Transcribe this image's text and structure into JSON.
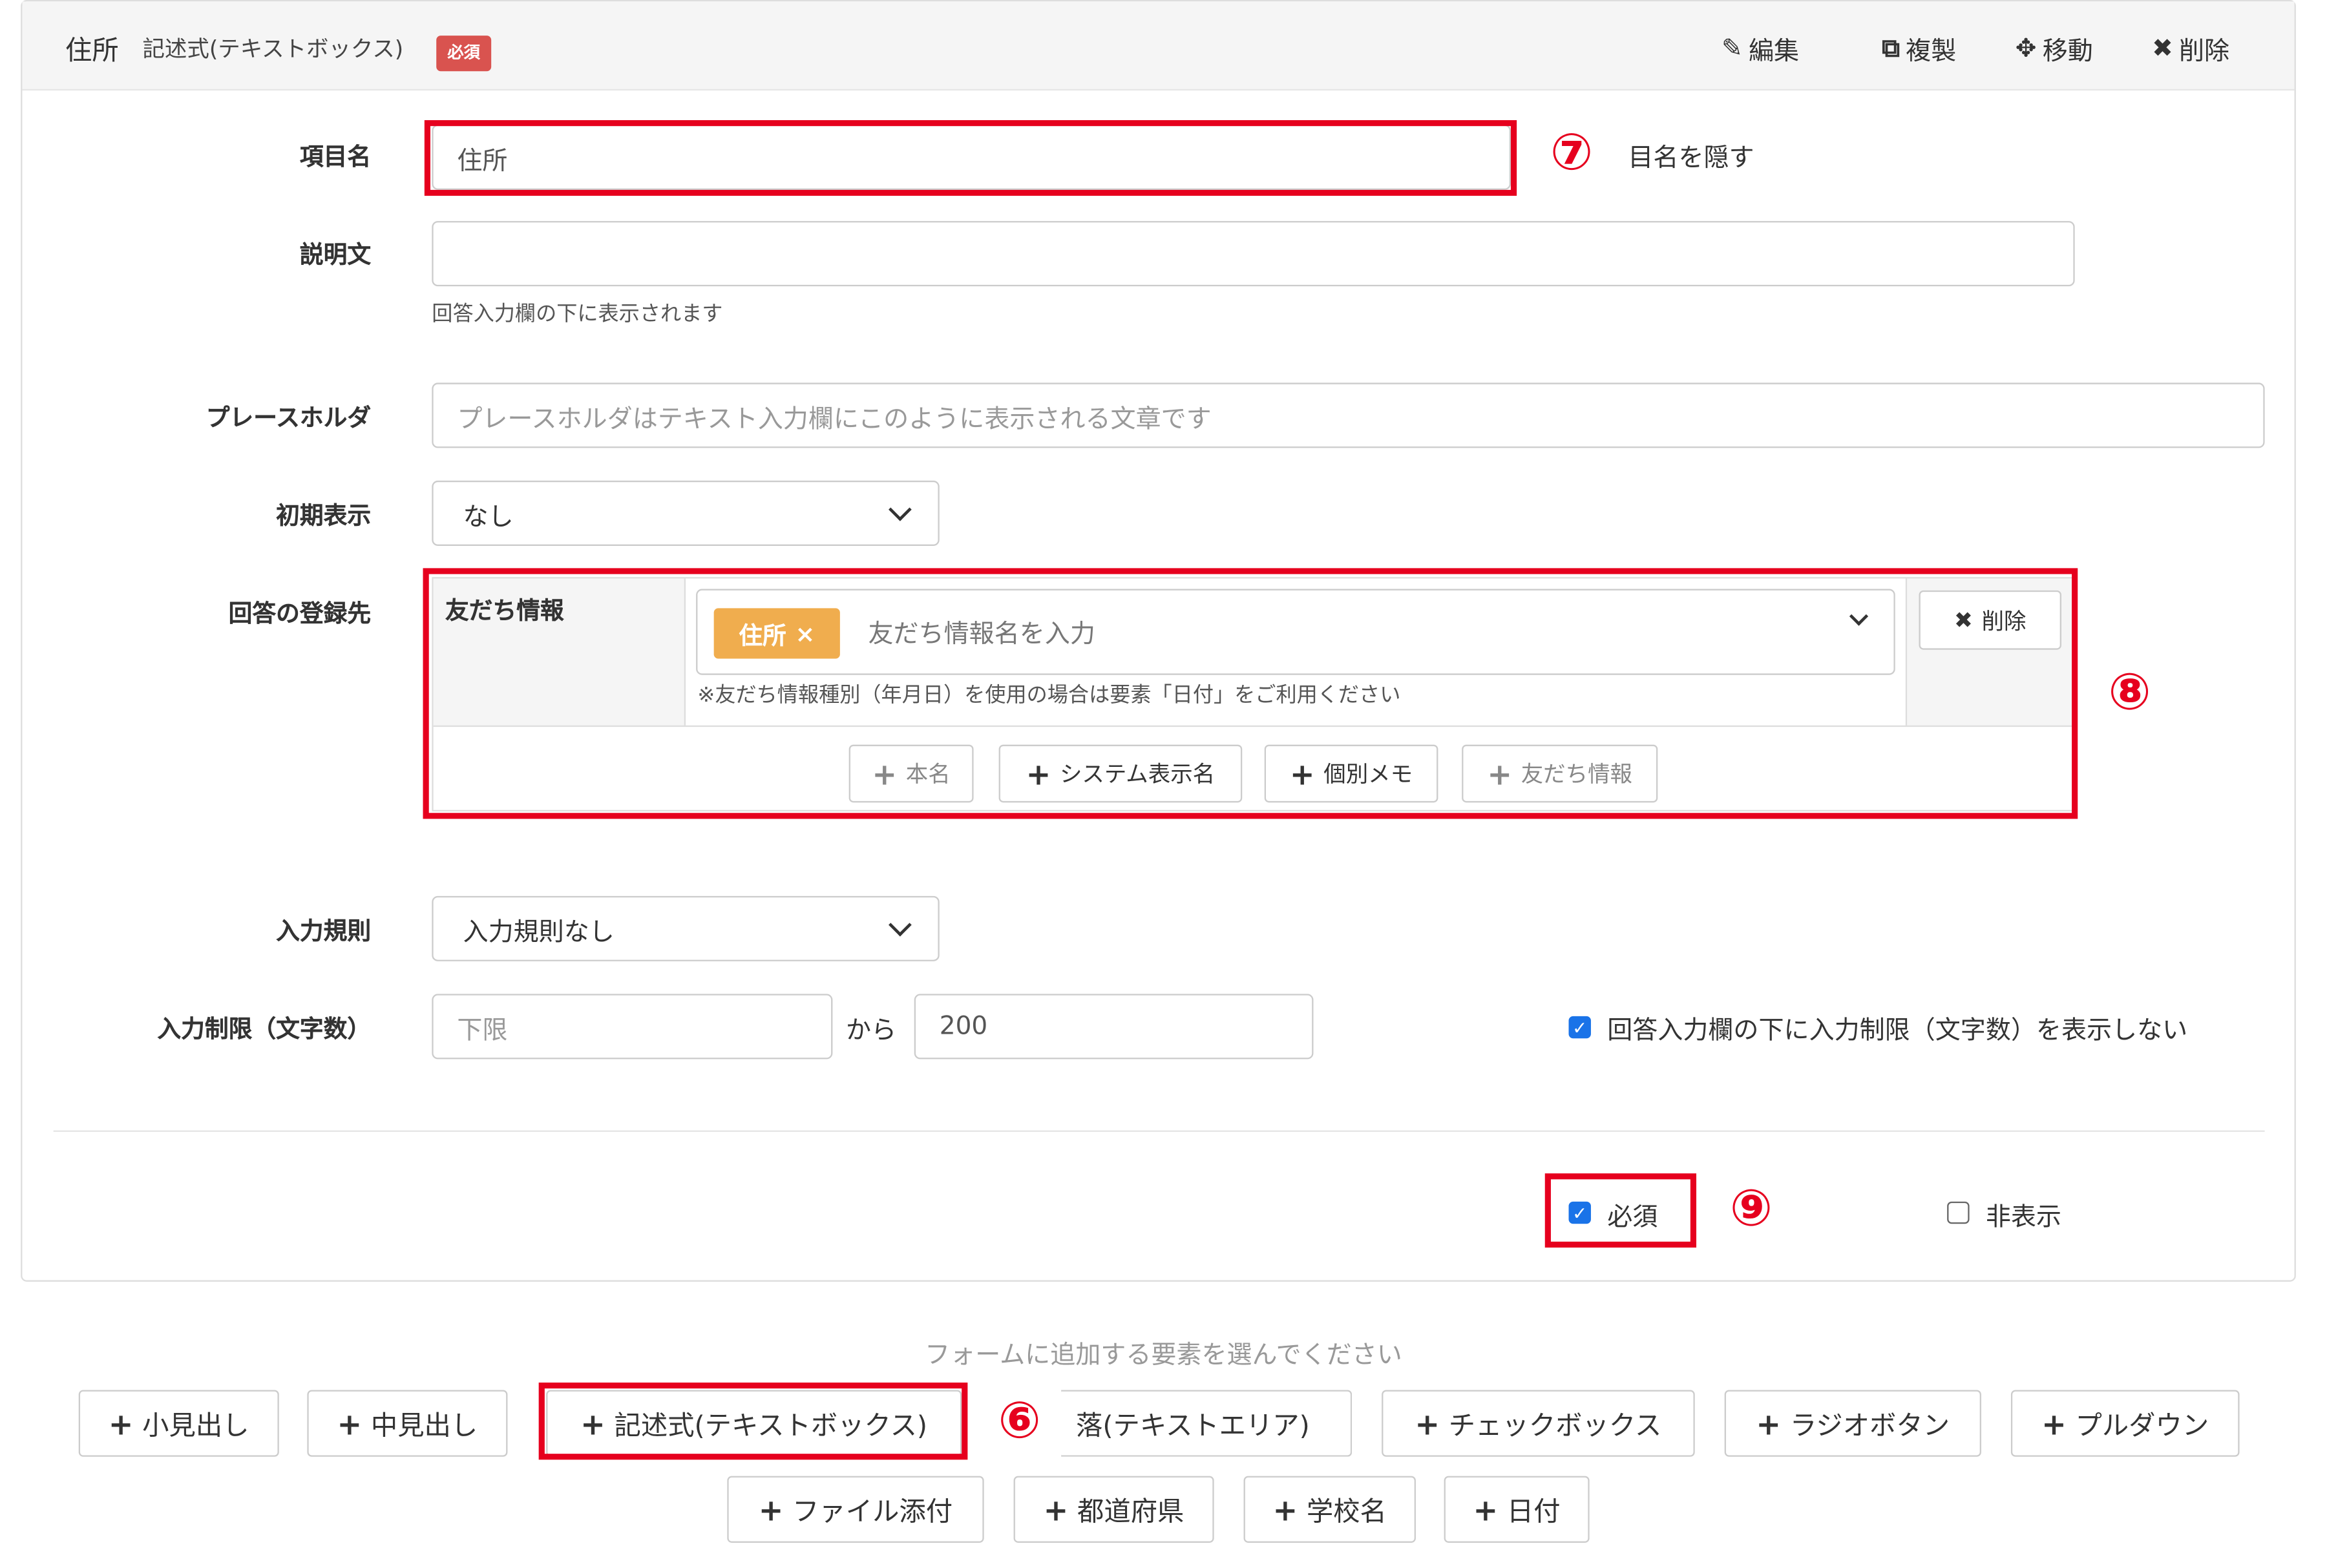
{
  "header": {
    "title": "住所",
    "subtitle": "記述式(テキストボックス)",
    "required_badge": "必須",
    "actions": {
      "edit": "編集",
      "duplicate": "複製",
      "move": "移動",
      "delete": "削除"
    }
  },
  "fields": {
    "item_name": {
      "label": "項目名",
      "value": "住所",
      "hide_label_text": "目名を隠す"
    },
    "description": {
      "label": "説明文",
      "value": "",
      "help": "回答入力欄の下に表示されます"
    },
    "placeholder": {
      "label": "プレースホルダ",
      "placeholder": "プレースホルダはテキスト入力欄にこのように表示される文章です"
    },
    "initial_display": {
      "label": "初期表示",
      "value": "なし"
    },
    "registration": {
      "label": "回答の登録先",
      "sub_label": "友だち情報",
      "tag": "住所",
      "tag_remove": "×",
      "input_placeholder": "友だち情報名を入力",
      "note": "※友だち情報種別（年月日）を使用の場合は要素「日付」をご利用ください",
      "delete_button": "削除",
      "add_buttons": [
        "本名",
        "システム表示名",
        "個別メモ",
        "友だち情報"
      ]
    },
    "input_rule": {
      "label": "入力規則",
      "value": "入力規則なし"
    },
    "input_limit": {
      "label": "入力制限（文字数）",
      "min_placeholder": "下限",
      "between": "から",
      "max_value": "200",
      "hide_limit_text": "回答入力欄の下に入力制限（文字数）を表示しない",
      "hide_limit_checked": true
    },
    "required": {
      "label": "必須",
      "checked": true
    },
    "hidden": {
      "label": "非表示",
      "checked": false
    }
  },
  "annotations": {
    "seven": "⑦",
    "eight": "⑧",
    "nine": "⑨",
    "six": "⑥"
  },
  "add_elements": {
    "prompt": "フォームに追加する要素を選んでください",
    "row1": [
      "小見出し",
      "中見出し",
      "記述式(テキストボックス)",
      "落(テキストエリア)",
      "チェックボックス",
      "ラジオボタン",
      "プルダウン"
    ],
    "row2": [
      "ファイル添付",
      "都道府県",
      "学校名",
      "日付"
    ]
  },
  "colors": {
    "highlight_red": "#e6001e",
    "tag_orange": "#f0ad4e",
    "badge_red": "#d9534f",
    "checkbox_blue": "#1a73e8"
  },
  "icons": {
    "edit": "pencil-icon",
    "duplicate": "copy-icon",
    "move": "move-arrows-icon",
    "delete": "x-icon",
    "add": "plus-icon",
    "dropdown": "chevron-down-icon"
  }
}
